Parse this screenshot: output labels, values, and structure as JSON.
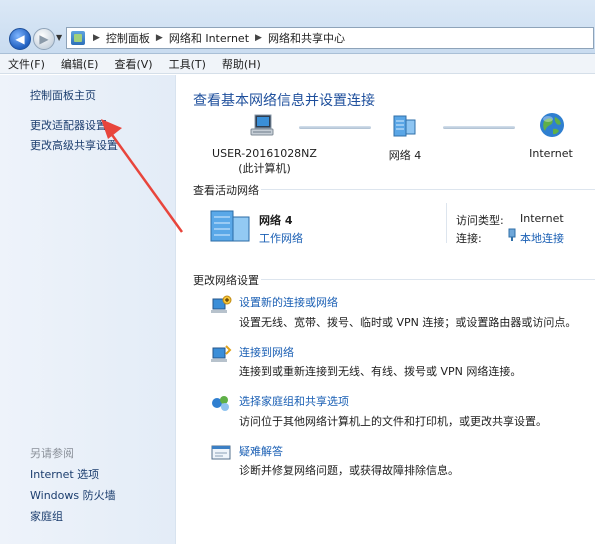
{
  "address_bar": {
    "crumbs": [
      "控制面板",
      "网络和 Internet",
      "网络和共享中心"
    ]
  },
  "menu": [
    "文件(F)",
    "编辑(E)",
    "查看(V)",
    "工具(T)",
    "帮助(H)"
  ],
  "sidebar": {
    "links": [
      "控制面板主页",
      "更改适配器设置",
      "更改高级共享设置"
    ],
    "see_also_title": "另请参阅",
    "see_also": [
      "Internet 选项",
      "Windows 防火墙",
      "家庭组"
    ]
  },
  "main": {
    "title": "查看基本网络信息并设置连接",
    "map": {
      "computer_name": "USER-20161028NZ",
      "computer_sub": "(此计算机)",
      "network": "网络  4",
      "internet": "Internet"
    },
    "active_section": "查看活动网络",
    "active": {
      "name": "网络  4",
      "type_link": "工作网络",
      "access_type_label": "访问类型:",
      "access_type_value": "Internet",
      "connection_label": "连接:",
      "connection_value": "本地连接"
    },
    "change_section": "更改网络设置",
    "tasks": [
      {
        "title": "设置新的连接或网络",
        "desc": "设置无线、宽带、拨号、临时或 VPN 连接；或设置路由器或访问点。"
      },
      {
        "title": "连接到网络",
        "desc": "连接到或重新连接到无线、有线、拨号或 VPN 网络连接。"
      },
      {
        "title": "选择家庭组和共享选项",
        "desc": "访问位于其他网络计算机上的文件和打印机，或更改共享设置。"
      },
      {
        "title": "疑难解答",
        "desc": "诊断并修复网络问题，或获得故障排除信息。"
      }
    ]
  },
  "colors": {
    "annotation_arrow": "#e8453c",
    "link": "#1a5fb4",
    "title": "#1e4f9c"
  },
  "icons": [
    "back-arrow-icon",
    "forward-arrow-icon",
    "control-panel-icon",
    "computer-icon",
    "network-icon",
    "globe-icon",
    "network-building-icon",
    "ethernet-plug-icon",
    "new-connection-icon",
    "connect-network-icon",
    "homegroup-icon",
    "troubleshoot-icon",
    "annotation-arrow"
  ]
}
